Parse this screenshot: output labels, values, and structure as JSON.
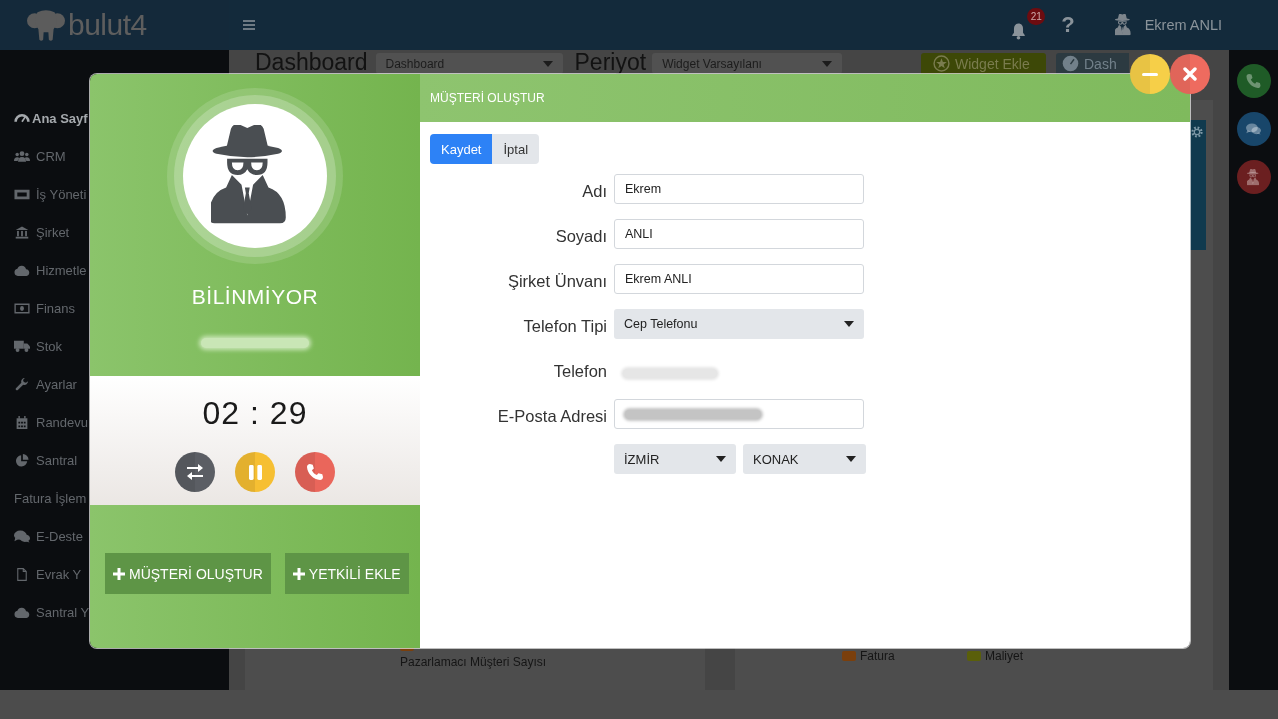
{
  "header": {
    "brand": "bulut4",
    "notifications": "21",
    "help": "?",
    "user": "Ekrem ANLI"
  },
  "sidebar": {
    "items": [
      {
        "label": "Ana Sayf",
        "kind": "link",
        "selected": true
      },
      {
        "label": "CRM",
        "kind": "link",
        "selected": false
      },
      {
        "label": "İş Yöneti",
        "kind": "link",
        "selected": false
      },
      {
        "label": "Şirket",
        "kind": "link",
        "selected": false
      },
      {
        "label": "Hizmetle",
        "kind": "link",
        "selected": false
      },
      {
        "label": "Finans",
        "kind": "link",
        "selected": false
      },
      {
        "label": "Stok",
        "kind": "link",
        "selected": false
      },
      {
        "label": "Ayarlar",
        "kind": "link",
        "selected": false
      },
      {
        "label": "Randevu",
        "kind": "link",
        "selected": false
      },
      {
        "label": "Santral",
        "kind": "link",
        "selected": false
      },
      {
        "label": "Fatura İşlem",
        "kind": "section",
        "selected": false
      },
      {
        "label": "E-Deste",
        "kind": "link",
        "selected": false
      },
      {
        "label": "Evrak Y",
        "kind": "link",
        "selected": false
      },
      {
        "label": "Santral Y",
        "kind": "link",
        "selected": false
      }
    ]
  },
  "dashboard": {
    "title": "Dashboard",
    "view_select": "Dashboard",
    "period_label": "Periyot",
    "period_select": "Widget Varsayılanı",
    "buttons": [
      {
        "label": "Widget Ekle",
        "color": "#3d4807"
      },
      {
        "label": "Dash",
        "color": "#2c3a41"
      }
    ],
    "left_legend": [
      {
        "label": "Pazarlamacı Müşteri Sayısı",
        "color": "#7a3f0c"
      }
    ],
    "right_legend": [
      {
        "label": "Fatura",
        "color": "#7a3f0c"
      },
      {
        "label": "Maliyet",
        "color": "#5a5f0a"
      }
    ]
  },
  "quick_actions": [
    {
      "color": "#1f5b27"
    },
    {
      "color": "#18466a"
    },
    {
      "color": "#6b1f20"
    }
  ],
  "call_panel": {
    "caller_name": "BİLİNMİYOR",
    "number_redacted": true,
    "timer": "02 : 29",
    "controls": [
      {
        "color": "#5b5e64"
      },
      {
        "color": "#f6bf32"
      },
      {
        "color": "#ea665b"
      }
    ],
    "actions": [
      "MÜŞTERİ OLUŞTUR",
      "YETKİLİ EKLE"
    ]
  },
  "form": {
    "title": "MÜŞTERİ OLUŞTUR",
    "buttons": [
      {
        "label": "Kaydet",
        "kind": "primary"
      },
      {
        "label": "İptal",
        "kind": "secondary"
      }
    ],
    "fields": [
      {
        "label": "Adı",
        "kind": "input",
        "value": "Ekrem",
        "redacted": false
      },
      {
        "label": "Soyadı",
        "kind": "input",
        "value": "ANLI",
        "redacted": false
      },
      {
        "label": "Şirket Ünvanı",
        "kind": "input",
        "value": "Ekrem ANLI",
        "redacted": false
      },
      {
        "label": "Telefon Tipi",
        "kind": "select",
        "value": "Cep Telefonu",
        "redacted": false
      },
      {
        "label": "Telefon",
        "kind": "text",
        "redacted": true
      },
      {
        "label": "E-Posta Adresi",
        "kind": "input",
        "redacted": true
      }
    ],
    "location": [
      "İZMİR",
      "KONAK"
    ]
  },
  "window_controls": [
    {
      "color": "#f6cf48"
    },
    {
      "color": "#ee6b5f"
    }
  ]
}
